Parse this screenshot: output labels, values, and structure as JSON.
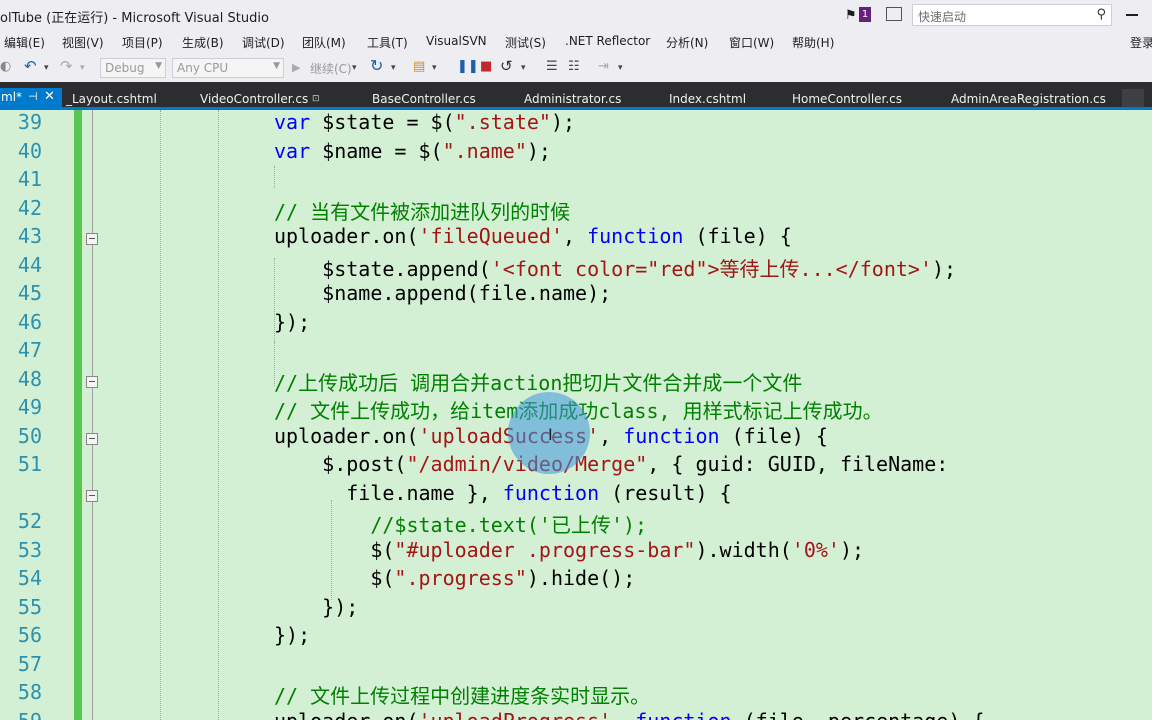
{
  "window": {
    "title": "olTube (正在运行) - Microsoft Visual Studio",
    "notification_count": "1",
    "quick_launch_placeholder": "快速启动"
  },
  "menu": [
    "编辑(E)",
    "视图(V)",
    "项目(P)",
    "生成(B)",
    "调试(D)",
    "团队(M)",
    "工具(T)",
    "VisualSVN",
    "测试(S)",
    ".NET Reflector",
    "分析(N)",
    "窗口(W)",
    "帮助(H)",
    "登录"
  ],
  "toolbar": {
    "config": "Debug",
    "platform": "Any CPU",
    "continue": "继续(C)"
  },
  "tabs": {
    "active": "ml*",
    "items": [
      "_Layout.cshtml",
      "VideoController.cs",
      "BaseController.cs",
      "Administrator.cs",
      "Index.cshtml",
      "HomeController.cs",
      "AdminAreaRegistration.cs"
    ]
  },
  "editor": {
    "line_numbers": [
      "39",
      "40",
      "41",
      "42",
      "43",
      "44",
      "45",
      "46",
      "47",
      "48",
      "49",
      "50",
      "51",
      "",
      "52",
      "53",
      "54",
      "55",
      "56",
      "57",
      "58",
      "59"
    ],
    "lines": [
      [
        {
          "t": "var",
          "c": "kw"
        },
        {
          "t": " $state = $(",
          "c": ""
        },
        {
          "t": "\".state\"",
          "c": "str"
        },
        {
          "t": ");",
          "c": ""
        }
      ],
      [
        {
          "t": "var",
          "c": "kw"
        },
        {
          "t": " $name = $(",
          "c": ""
        },
        {
          "t": "\".name\"",
          "c": "str"
        },
        {
          "t": ");",
          "c": ""
        }
      ],
      [],
      [
        {
          "t": "// 当有文件被添加进队列的时候",
          "c": "cmt"
        }
      ],
      [
        {
          "t": "uploader.on(",
          "c": ""
        },
        {
          "t": "'fileQueued'",
          "c": "str"
        },
        {
          "t": ", ",
          "c": ""
        },
        {
          "t": "function",
          "c": "kw"
        },
        {
          "t": " (file) {",
          "c": ""
        }
      ],
      [
        {
          "t": "    $state.append(",
          "c": ""
        },
        {
          "t": "'<font color=\"red\">等待上传...</font>'",
          "c": "str"
        },
        {
          "t": ");",
          "c": ""
        }
      ],
      [
        {
          "t": "    $name.append(file.name);",
          "c": ""
        }
      ],
      [
        {
          "t": "});",
          "c": ""
        }
      ],
      [],
      [
        {
          "t": "//上传成功后 调用合并action把切片文件合并成一个文件",
          "c": "cmt"
        }
      ],
      [
        {
          "t": "// 文件上传成功，给item添加成功class, 用样式标记上传成功。",
          "c": "cmt"
        }
      ],
      [
        {
          "t": "uploader.on(",
          "c": ""
        },
        {
          "t": "'uploadSuccess'",
          "c": "str"
        },
        {
          "t": ", ",
          "c": ""
        },
        {
          "t": "function",
          "c": "kw"
        },
        {
          "t": " (file) {",
          "c": ""
        }
      ],
      [
        {
          "t": "    $.post(",
          "c": ""
        },
        {
          "t": "\"/admin/video/Merge\"",
          "c": "str"
        },
        {
          "t": ", { guid: GUID, fileName:",
          "c": ""
        }
      ],
      [
        {
          "t": "      file.name }, ",
          "c": ""
        },
        {
          "t": "function",
          "c": "kw"
        },
        {
          "t": " (result) {",
          "c": ""
        }
      ],
      [
        {
          "t": "        //$state.text('已上传');",
          "c": "cmt"
        }
      ],
      [
        {
          "t": "        $(",
          "c": ""
        },
        {
          "t": "\"#uploader .progress-bar\"",
          "c": "str"
        },
        {
          "t": ").width(",
          "c": ""
        },
        {
          "t": "'0%'",
          "c": "str"
        },
        {
          "t": ");",
          "c": ""
        }
      ],
      [
        {
          "t": "        $(",
          "c": ""
        },
        {
          "t": "\".progress\"",
          "c": "str"
        },
        {
          "t": ").hide();",
          "c": ""
        }
      ],
      [
        {
          "t": "    });",
          "c": ""
        }
      ],
      [
        {
          "t": "});",
          "c": ""
        }
      ],
      [],
      [
        {
          "t": "// 文件上传过程中创建进度条实时显示。",
          "c": "cmt"
        }
      ],
      [
        {
          "t": "uploader.on(",
          "c": ""
        },
        {
          "t": "'uploadProgress'",
          "c": "str"
        },
        {
          "t": ", ",
          "c": ""
        },
        {
          "t": "function",
          "c": "kw"
        },
        {
          "t": " (file, percentage) {",
          "c": ""
        }
      ]
    ]
  }
}
